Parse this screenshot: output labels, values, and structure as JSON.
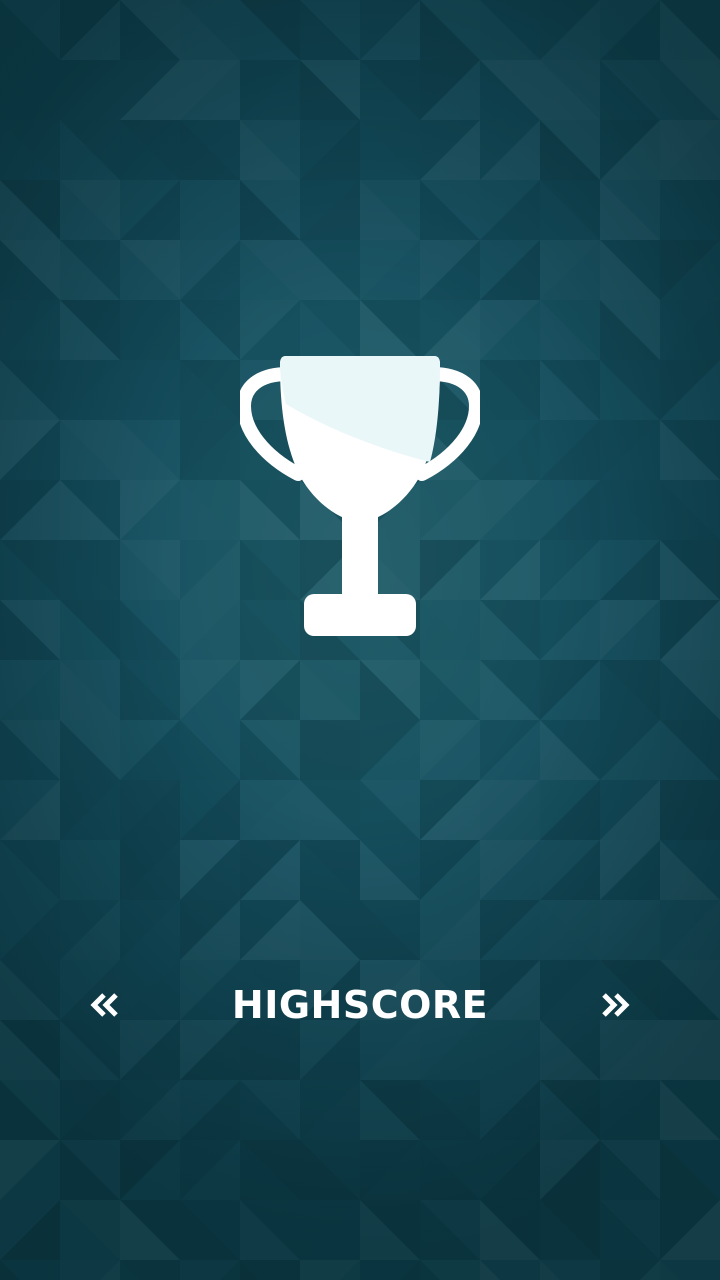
{
  "screen": {
    "title": "HIGHSCORE",
    "background_color": "#13505c",
    "icon": "trophy-icon"
  },
  "navigation": {
    "previous_icon": "double-chevron-left-icon",
    "next_icon": "double-chevron-right-icon"
  }
}
